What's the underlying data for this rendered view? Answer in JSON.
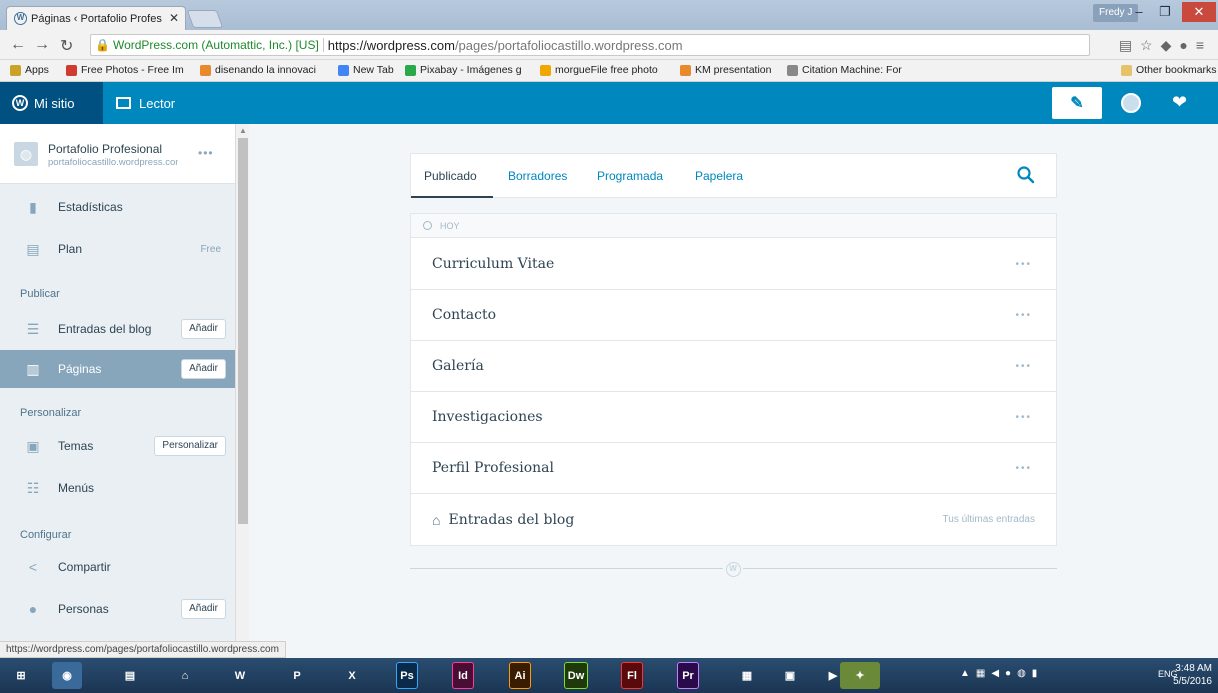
{
  "browser": {
    "tab_title": "Páginas ‹ Portafolio Profes",
    "tab_close": "✕",
    "user": "Fredy J",
    "address": {
      "identity": "WordPress.com (Automattic, Inc.) [US]",
      "host": "https://wordpress.com",
      "path": "/pages/portafoliocastillo.wordpress.com"
    },
    "bookmarks": [
      {
        "label": "Apps",
        "color": "#c9a227"
      },
      {
        "label": "Free Photos - Free Im",
        "color": "#d03b2f"
      },
      {
        "label": "disenando la innovaci",
        "color": "#e8892b"
      },
      {
        "label": "New Tab",
        "color": "#4285f4"
      },
      {
        "label": "Pixabay - Imágenes g",
        "color": "#2aa84a"
      },
      {
        "label": "morgueFile free photo",
        "color": "#f0a800"
      },
      {
        "label": "KM presentation",
        "color": "#e8892b"
      },
      {
        "label": "Citation Machine: For",
        "color": "#888888"
      }
    ],
    "other_bookmarks": "Other bookmarks",
    "status_url": "https://wordpress.com/pages/portafoliocastillo.wordpress.com"
  },
  "masterbar": {
    "my_site": "Mi sitio",
    "reader": "Lector"
  },
  "sidebar": {
    "site_name": "Portafolio Profesional",
    "site_url": "portafoliocastillo.wordpress.com",
    "more": "•••",
    "stats": "Estadísticas",
    "plan": "Plan",
    "plan_badge": "Free",
    "heading_publish": "Publicar",
    "posts": "Entradas del blog",
    "posts_add": "Añadir",
    "pages": "Páginas",
    "pages_add": "Añadir",
    "heading_personalize": "Personalizar",
    "themes": "Temas",
    "themes_btn": "Personalizar",
    "menus": "Menús",
    "heading_configure": "Configurar",
    "share": "Compartir",
    "people": "Personas",
    "people_add": "Añadir"
  },
  "main": {
    "tabs": [
      {
        "label": "Publicado"
      },
      {
        "label": "Borradores"
      },
      {
        "label": "Programada"
      },
      {
        "label": "Papelera"
      }
    ],
    "section_label": "HOY",
    "pages": [
      {
        "title": "Curriculum Vitae"
      },
      {
        "title": "Contacto"
      },
      {
        "title": "Galería"
      },
      {
        "title": "Investigaciones"
      },
      {
        "title": "Perfil Profesional"
      }
    ],
    "row_more": "•••",
    "blog_row_title": "Entradas del blog",
    "blog_row_sub": "Tus últimas entradas"
  },
  "taskbar": {
    "apps": [
      {
        "label": "Ps",
        "color": "#0b2a4a"
      },
      {
        "label": "Id",
        "color": "#4a0d36"
      },
      {
        "label": "Ai",
        "color": "#3a1c00"
      },
      {
        "label": "Dw",
        "color": "#1f3a0a"
      },
      {
        "label": "Fl",
        "color": "#5a0a0a"
      },
      {
        "label": "Pr",
        "color": "#2a0a4a"
      }
    ],
    "lang": "ENG",
    "time": "3:48 AM",
    "date": "5/5/2016"
  },
  "colors": {
    "wp_blue": "#0087be",
    "wp_dark_blue": "#005082",
    "text_dark": "#2e4453",
    "text_muted": "#87a6bc"
  }
}
